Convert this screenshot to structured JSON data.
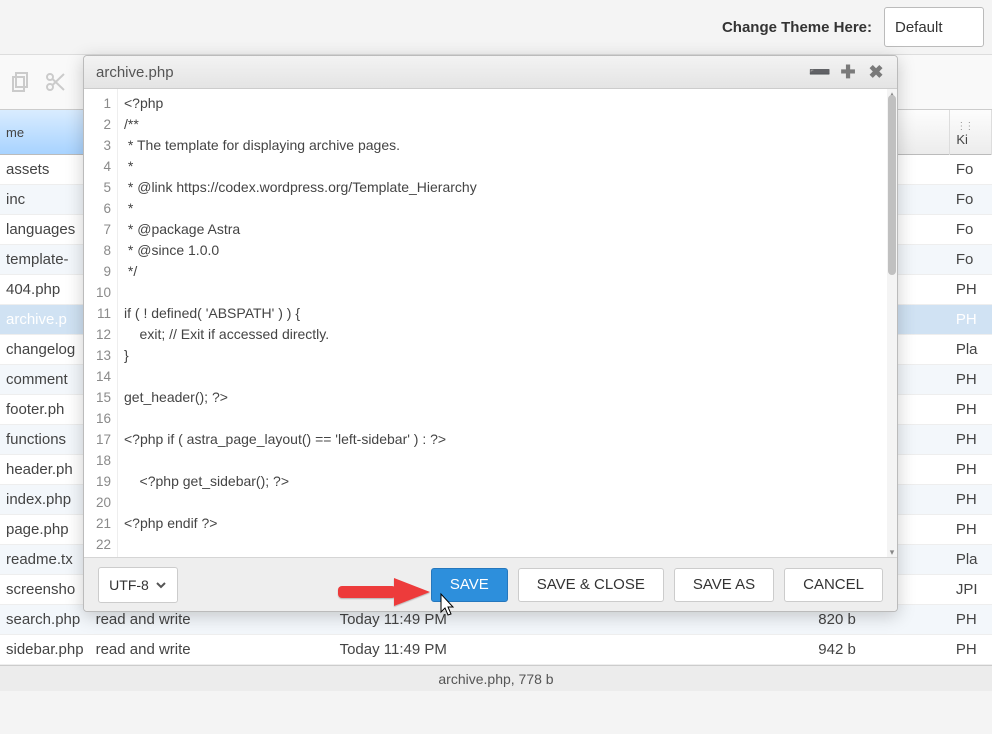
{
  "topbar": {
    "label": "Change Theme Here:",
    "select_value": "Default"
  },
  "bg": {
    "headers": {
      "name": "me",
      "col2": " ",
      "kind": " Ki"
    },
    "rows": [
      {
        "name": "assets",
        "perm": "",
        "date": "",
        "size": "",
        "kind": "Fo"
      },
      {
        "name": "inc",
        "perm": "",
        "date": "",
        "size": "",
        "kind": "Fo"
      },
      {
        "name": "languages",
        "perm": "",
        "date": "",
        "size": "",
        "kind": "Fo"
      },
      {
        "name": "template-",
        "perm": "",
        "date": "",
        "size": "",
        "kind": "Fo"
      },
      {
        "name": "404.php",
        "perm": "",
        "date": "",
        "size": "",
        "kind": "PH"
      },
      {
        "name": "archive.p",
        "perm": "",
        "date": "",
        "size": "",
        "kind": "PH"
      },
      {
        "name": "changelog",
        "perm": "",
        "date": "",
        "size": "",
        "kind": "Pla"
      },
      {
        "name": "comment",
        "perm": "",
        "date": "",
        "size": "",
        "kind": "PH"
      },
      {
        "name": "footer.ph",
        "perm": "",
        "date": "",
        "size": "",
        "kind": "PH"
      },
      {
        "name": "functions",
        "perm": "",
        "date": "",
        "size": "",
        "kind": "PH"
      },
      {
        "name": "header.ph",
        "perm": "",
        "date": "",
        "size": "",
        "kind": "PH"
      },
      {
        "name": "index.php",
        "perm": "",
        "date": "",
        "size": "",
        "kind": "PH"
      },
      {
        "name": "page.php",
        "perm": "",
        "date": "",
        "size": "",
        "kind": "PH"
      },
      {
        "name": "readme.tx",
        "perm": "",
        "date": "",
        "size": "",
        "kind": "Pla"
      },
      {
        "name": "screensho",
        "perm": "",
        "date": "",
        "size": "",
        "kind": "JPI"
      },
      {
        "name": "search.php",
        "perm": "read and write",
        "date": "Today 11:49 PM",
        "size": "820 b",
        "kind": "PH"
      },
      {
        "name": "sidebar.php",
        "perm": "read and write",
        "date": "Today 11:49 PM",
        "size": "942 b",
        "kind": "PH"
      }
    ],
    "status": "archive.php, 778 b"
  },
  "editor": {
    "title": "archive.php",
    "lines": [
      "<?php",
      "/**",
      " * The template for displaying archive pages.",
      " *",
      " * @link https://codex.wordpress.org/Template_Hierarchy",
      " *",
      " * @package Astra",
      " * @since 1.0.0",
      " */",
      "",
      "if ( ! defined( 'ABSPATH' ) ) {",
      "\texit; // Exit if accessed directly.",
      "}",
      "",
      "get_header(); ?>",
      "",
      "<?php if ( astra_page_layout() == 'left-sidebar' ) : ?>",
      "",
      "\t<?php get_sidebar(); ?>",
      "",
      "<?php endif ?>",
      ""
    ],
    "encoding": "UTF-8",
    "buttons": {
      "save": "SAVE",
      "save_close": "SAVE & CLOSE",
      "save_as": "SAVE AS",
      "cancel": "CANCEL"
    }
  }
}
